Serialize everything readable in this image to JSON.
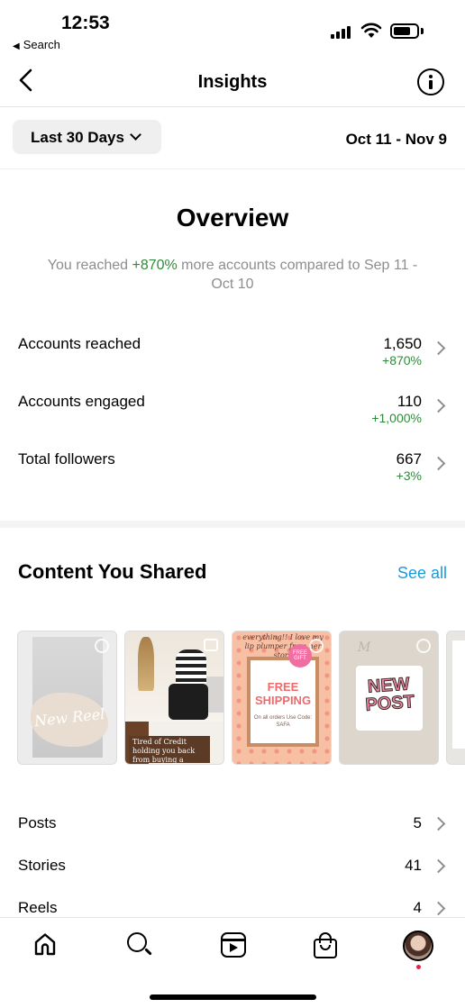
{
  "status_bar": {
    "time": "12:53",
    "back_app": "Search"
  },
  "nav": {
    "title": "Insights"
  },
  "filter": {
    "range_label": "Last 30 Days",
    "date_range": "Oct 11 - Nov 9"
  },
  "overview": {
    "title": "Overview",
    "subtitle_before": "You reached ",
    "subtitle_pct": "+870%",
    "subtitle_after": " more accounts compared to Sep 11 - Oct 10",
    "metrics": [
      {
        "label": "Accounts reached",
        "value": "1,650",
        "change": "+870%"
      },
      {
        "label": "Accounts engaged",
        "value": "110",
        "change": "+1,000%"
      },
      {
        "label": "Total followers",
        "value": "667",
        "change": "+3%"
      }
    ]
  },
  "content": {
    "title": "Content You Shared",
    "see_all": "See all",
    "thumbnails": [
      {
        "text": "New Reel"
      },
      {
        "text": "Tired of Credit holding you back from buying a home?"
      },
      {
        "top_text": "everything!! I love my lip plumper from her store",
        "text": "FREE SHIPPING",
        "sub": "On all orders Use Code: SAFA",
        "badge": "FREE GIFT"
      },
      {
        "text": "NEW POST"
      },
      {
        "text": ""
      }
    ],
    "rows": [
      {
        "label": "Posts",
        "value": "5"
      },
      {
        "label": "Stories",
        "value": "41"
      },
      {
        "label": "Reels",
        "value": "4"
      }
    ]
  },
  "colors": {
    "positive": "#2e8b3a",
    "link": "#1a9bd7",
    "notification": "#ed1c49"
  },
  "icons": [
    "back-chevron-icon",
    "info-icon",
    "chevron-down-icon",
    "chevron-right-icon",
    "home-icon",
    "search-icon",
    "reels-icon",
    "shop-icon",
    "avatar"
  ]
}
